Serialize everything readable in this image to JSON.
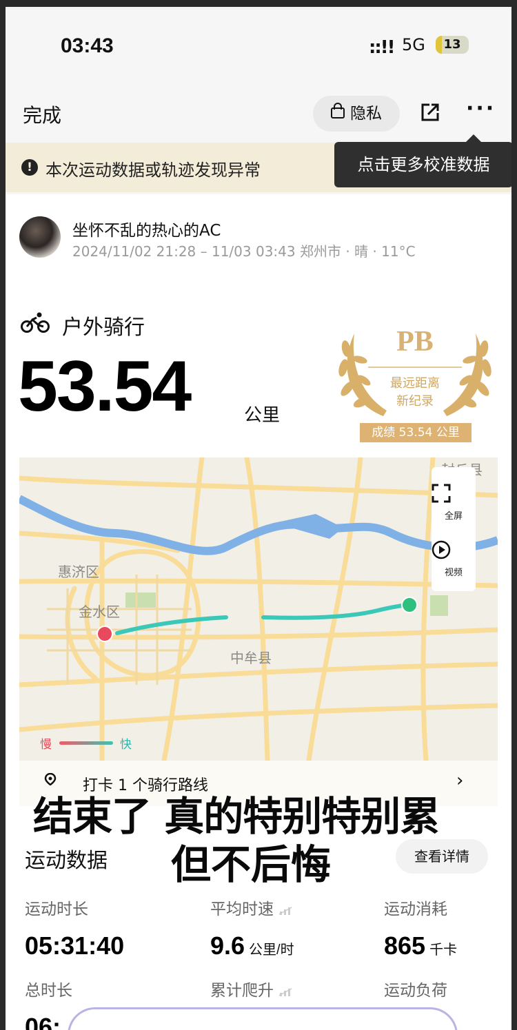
{
  "status_bar": {
    "time": "03:43",
    "signal": "::!!",
    "network": "5G",
    "battery": "13"
  },
  "nav": {
    "done": "完成",
    "privacy": "隐私",
    "share_icon": "share-icon",
    "more": "···"
  },
  "warning": {
    "text": "本次运动数据或轨迹发现异常",
    "icon": "!"
  },
  "tooltip": "点击更多校准数据",
  "user": {
    "name": "坐怀不乱的热心的AC",
    "meta": "2024/11/02 21:28 – 11/03 03:43 郑州市 · 晴 · 11°C"
  },
  "activity": {
    "type": "户外骑行",
    "distance": "53.54",
    "unit": "公里"
  },
  "pb": {
    "title": "PB",
    "line1": "最远距离",
    "line2": "新纪录",
    "badge": "成绩 53.54 公里"
  },
  "map": {
    "labels": {
      "fengqiu": "封丘县",
      "huiji": "惠济区",
      "jinshui": "金水区",
      "zhongmou": "中牟县"
    },
    "fullscreen": "全屏",
    "video": "视频",
    "legend_slow": "慢",
    "legend_fast": "快",
    "colors": {
      "track": "#3cc8b8",
      "start": "#e84a5c",
      "end": "#2fbf7e",
      "river": "#7fb0e6",
      "road": "#f7d98e"
    }
  },
  "checkin": {
    "text": "打卡 1 个骑行路线",
    "chevron": "›"
  },
  "caption": {
    "line1": "结束了 真的特别特别累",
    "line2": "但不后悔"
  },
  "stats_section": {
    "title": "运动数据",
    "detail_button": "查看详情",
    "items": [
      {
        "label": "运动时长",
        "value": "05:31:40",
        "unit": ""
      },
      {
        "label": "平均时速",
        "value": "9.6",
        "unit": "公里/时"
      },
      {
        "label": "运动消耗",
        "value": "865",
        "unit": "千卡"
      },
      {
        "label": "总时长",
        "value": "06:",
        "unit": ""
      },
      {
        "label": "累计爬升",
        "value": "",
        "unit": ""
      },
      {
        "label": "运动负荷",
        "value": "",
        "unit": ""
      }
    ]
  }
}
